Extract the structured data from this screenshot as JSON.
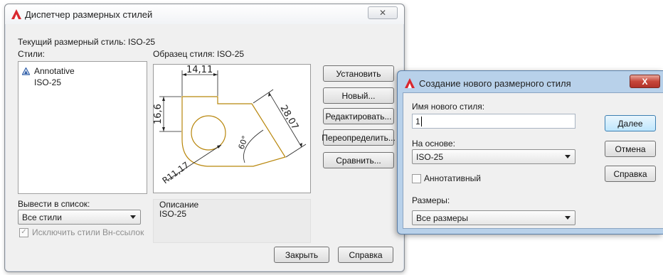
{
  "main_dialog": {
    "title": "Диспетчер размерных стилей",
    "close_glyph": "✕",
    "current_style_label": "Текущий размерный стиль: ISO-25",
    "styles_label": "Стили:",
    "styles": [
      {
        "name": "Annotative",
        "icon": "annotative-icon"
      },
      {
        "name": "ISO-25",
        "icon": ""
      }
    ],
    "preview_label": "Образец стиля: ISO-25",
    "preview_dims": {
      "top": "14,11",
      "left": "16,6",
      "diag": "28,07",
      "angle": "60°",
      "radius": "R11,17"
    },
    "buttons": {
      "set": "Установить",
      "new": "Новый...",
      "edit": "Редактировать...",
      "override": "Переопределить...",
      "compare": "Сравнить...",
      "close": "Закрыть",
      "help": "Справка"
    },
    "list_label": "Вывести в список:",
    "list_value": "Все стили",
    "exclude_xref_label": "Исключить стили Вн-ссылок",
    "exclude_xref_checked": true,
    "description_label": "Описание",
    "description_text": "ISO-25"
  },
  "new_style_dialog": {
    "title": "Создание нового размерного стиля",
    "close_glyph": "X",
    "name_label": "Имя нового стиля:",
    "name_value": "1",
    "based_on_label": "На основе:",
    "based_on_value": "ISO-25",
    "annotative_label": "Аннотативный",
    "annotative_checked": false,
    "use_for_label": "Размеры:",
    "use_for_value": "Все размеры",
    "buttons": {
      "continue": "Далее",
      "cancel": "Отмена",
      "help": "Справка"
    }
  },
  "colors": {
    "preview_geometry": "#b8860b",
    "app_icon": "#d9282f"
  }
}
